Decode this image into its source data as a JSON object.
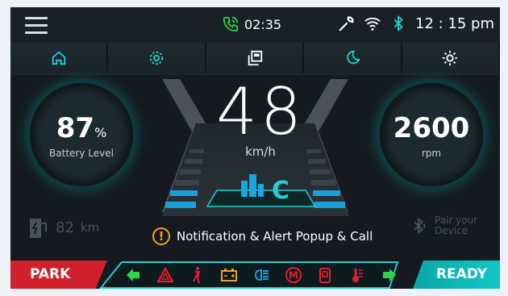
{
  "status": {
    "call_time": "02:35",
    "clock": "12 : 15 pm"
  },
  "nav": {
    "tabs": [
      "home-icon",
      "settings-gear-icon",
      "windows-icon",
      "night-mode-moon-icon",
      "brightness-sun-icon"
    ],
    "active_color": "#1fd1d1"
  },
  "battery": {
    "value": "87",
    "unit": "%",
    "label": "Battery Level"
  },
  "rpm": {
    "value": "2600",
    "label": "rpm"
  },
  "speed": {
    "value": "48",
    "unit": "km/h"
  },
  "mode": {
    "letter": "C"
  },
  "range": {
    "value": "82",
    "unit": "km"
  },
  "bluetooth": {
    "line1": "Pair your",
    "line2": "Device"
  },
  "notification": {
    "text": "Notification & Alert Popup & Call"
  },
  "bottom": {
    "park_label": "PARK",
    "ready_label": "READY",
    "telltales": [
      "left-arrow-icon",
      "hazard-icon",
      "seatbelt-icon",
      "battery-icon",
      "headlight-icon",
      "motor-icon",
      "fuel-icon",
      "temperature-icon",
      "right-arrow-icon"
    ]
  },
  "colors": {
    "accent": "#1fd1d1",
    "green": "#2fd24a",
    "red": "#e0222e",
    "orange": "#f0a020"
  }
}
